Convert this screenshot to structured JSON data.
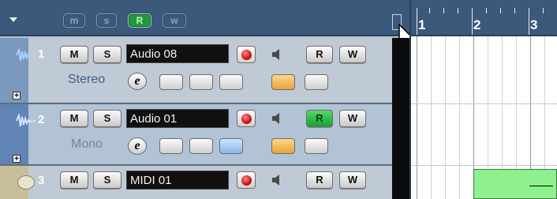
{
  "header": {
    "buttons": [
      "m",
      "s",
      "R",
      "w"
    ],
    "active_index": 2
  },
  "ruler": {
    "numbers": [
      "1",
      "2",
      "3"
    ]
  },
  "tracks": [
    {
      "number": "1",
      "name": "Audio 08",
      "channel": "Stereo",
      "type": "audio",
      "mute": "M",
      "solo": "S",
      "read": "R",
      "write": "W",
      "read_active": false,
      "edit": "e"
    },
    {
      "number": "2",
      "name": "Audio 01",
      "channel": "Mono",
      "type": "audio",
      "mute": "M",
      "solo": "S",
      "read": "R",
      "write": "W",
      "read_active": true,
      "edit": "e"
    },
    {
      "number": "3",
      "name": "MIDI 01",
      "channel": "",
      "type": "midi",
      "mute": "M",
      "solo": "S",
      "read": "R",
      "write": "W",
      "read_active": false,
      "edit": ""
    }
  ],
  "plus_label": "+",
  "colors": {
    "header_bg": "#3c587a",
    "track_bg": "#c0cad6",
    "track_selected_bg": "#b2c3d6",
    "record": "#d10f0f",
    "active_green": "#1f9a3c",
    "midi_part": "#8ef08e"
  }
}
